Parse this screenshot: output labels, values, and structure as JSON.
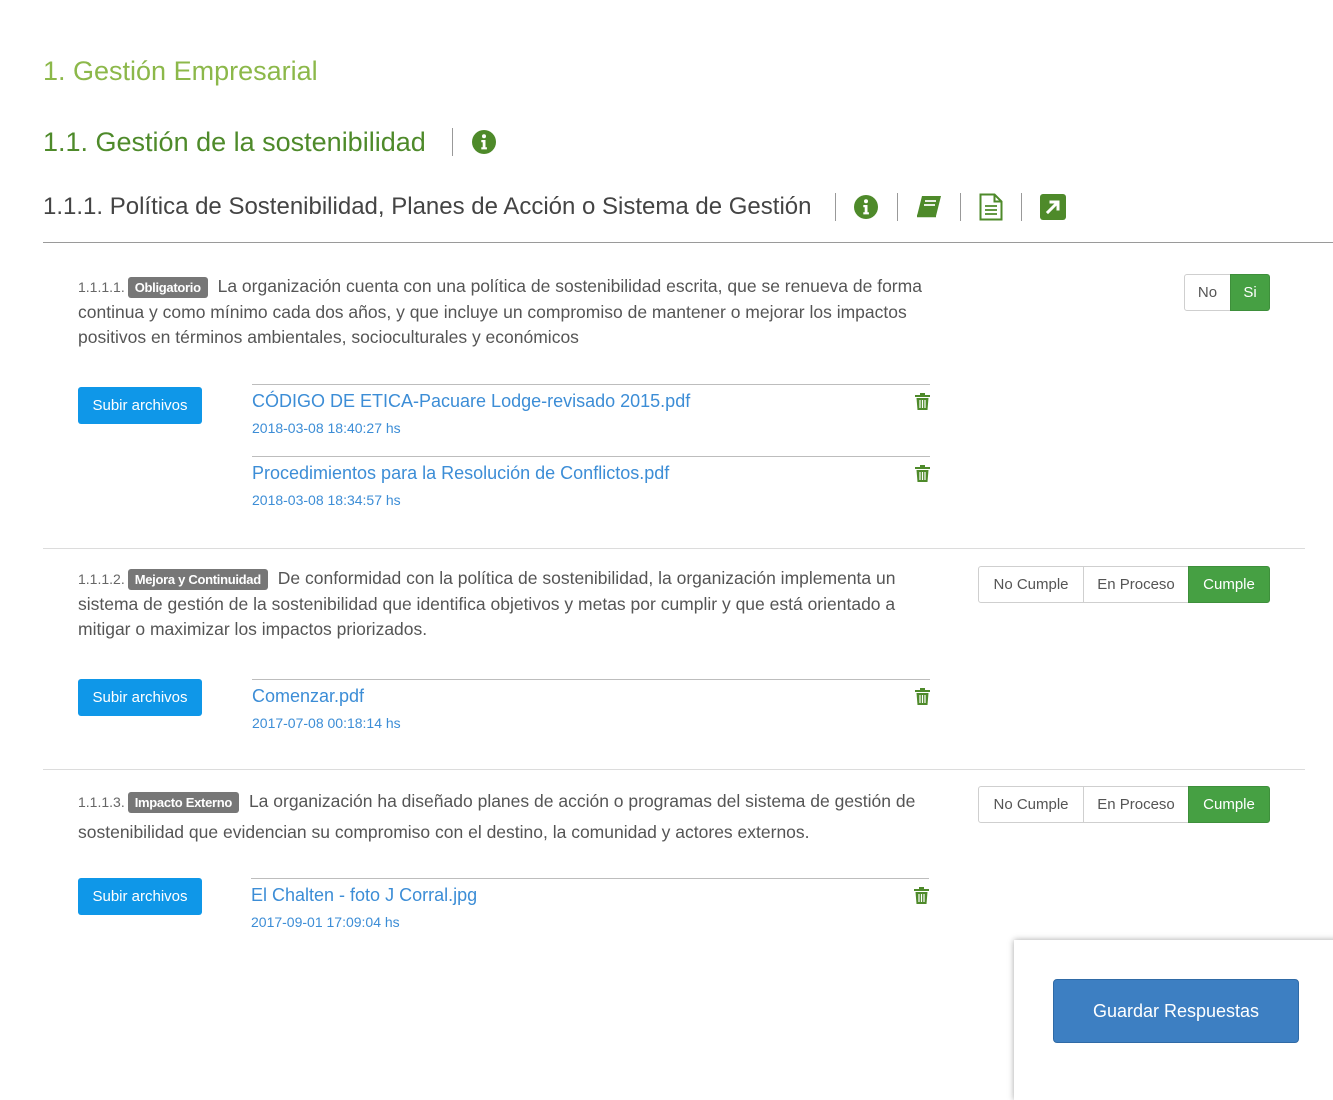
{
  "header": {
    "section_title": "1. Gestión Empresarial",
    "subsection_title": "1.1. Gestión de la sostenibilidad",
    "criterion_title": "1.1.1. Política de Sostenibilidad, Planes de Acción o Sistema de Gestión"
  },
  "colors": {
    "accent_green": "#4e8a2a",
    "light_green": "#8cb84a",
    "upload_blue": "#0f97e8",
    "link_blue": "#3c8dd6",
    "save_blue": "#3d7fc2"
  },
  "questions": [
    {
      "number": "1.1.1.1.",
      "badge": "Obligatorio",
      "text": "La organización cuenta con una política de sostenibilidad escrita, que se renueva de forma continua y como mínimo cada dos años, y que incluye un compromiso de mantener o mejorar los impactos positivos en términos ambientales, socioculturales y económicos",
      "options": [
        "No",
        "Si"
      ],
      "selected": "Si",
      "upload_label": "Subir archivos",
      "files": [
        {
          "name": "CÓDIGO DE ETICA-Pacuare Lodge-revisado 2015.pdf",
          "date": "2018-03-08 18:40:27 hs"
        },
        {
          "name": "Procedimientos para la Resolución de Conflictos.pdf",
          "date": "2018-03-08 18:34:57 hs"
        }
      ]
    },
    {
      "number": "1.1.1.2.",
      "badge": "Mejora y Continuidad",
      "text": "De conformidad con la política de sostenibilidad, la organización implementa un sistema de gestión de la sostenibilidad que identifica objetivos y metas por cumplir y que está orientado a mitigar o maximizar los impactos priorizados.",
      "options": [
        "No Cumple",
        "En Proceso",
        "Cumple"
      ],
      "selected": "Cumple",
      "upload_label": "Subir archivos",
      "files": [
        {
          "name": "Comenzar.pdf",
          "date": "2017-07-08 00:18:14 hs"
        }
      ]
    },
    {
      "number": "1.1.1.3.",
      "badge": "Impacto Externo",
      "text": "La organización ha diseñado planes de acción o programas del sistema de gestión de sostenibilidad que evidencian su compromiso con el destino, la comunidad y actores externos.",
      "options": [
        "No Cumple",
        "En Proceso",
        "Cumple"
      ],
      "selected": "Cumple",
      "upload_label": "Subir archivos",
      "files": [
        {
          "name": "El Chalten - foto J Corral.jpg",
          "date": "2017-09-01 17:09:04 hs"
        }
      ]
    }
  ],
  "save_button": "Guardar Respuestas"
}
